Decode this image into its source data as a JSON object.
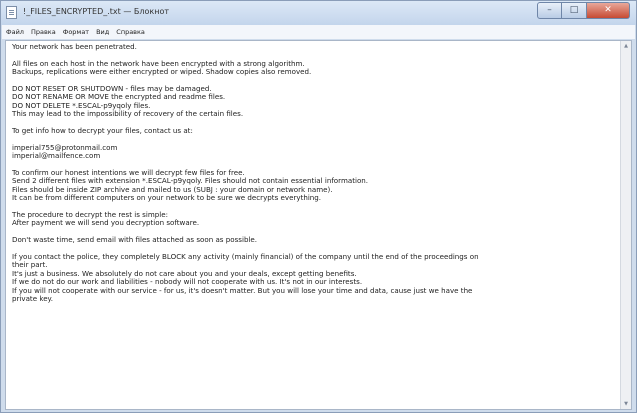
{
  "window": {
    "title": "!_FILES_ENCRYPTED_.txt — Блокнот",
    "minimize_glyph": "–",
    "maximize_glyph": "□",
    "close_glyph": "✕"
  },
  "menu": [
    "Файл",
    "Правка",
    "Формат",
    "Вид",
    "Справка"
  ],
  "document": {
    "paragraphs": [
      [
        "Your network has been penetrated."
      ],
      [
        "All files on each host in the network have been encrypted with a strong algorithm.",
        "Backups, replications were either encrypted or wiped. Shadow copies also removed."
      ],
      [
        "DO NOT RESET OR SHUTDOWN - files may be damaged.",
        "DO NOT RENAME OR MOVE the encrypted and readme files.",
        "DO NOT DELETE *.ESCAL-p9yqoly files.",
        "This may lead to the impossibility of recovery of the certain files."
      ],
      [
        "To get info how to decrypt your files, contact us at:"
      ],
      [
        "imperial755@protonmail.com",
        "imperial@mailfence.com"
      ],
      [
        "To confirm our honest intentions we will decrypt few files for free.",
        "Send 2 different files with extension *.ESCAL-p9yqoly. Files should not contain essential information.",
        "Files should be inside ZIP archive and mailed to us (SUBJ : your domain or network name).",
        "It can be from different computers on your network to be sure we decrypts everything."
      ],
      [
        "The procedure to decrypt the rest is simple:",
        "After payment we will send you decryption software."
      ],
      [
        "Don't waste time, send email with files attached as soon as possible."
      ],
      [
        "If you contact the police, they completely BLOCK any activity (mainly financial) of the company until the end of the proceedings on",
        "their part.",
        "It's just a business. We absolutely do not care about you and your deals, except getting benefits.",
        "If we do not do our work and liabilities - nobody will not cooperate with us. It's not in our interests.",
        "If you will not cooperate with our service - for us, it's doesn't matter. But you will lose your time and data, cause just we have the",
        "private key."
      ]
    ]
  },
  "icons": {
    "app": "notepad-icon",
    "scroll_up": "scroll-up-arrow-icon",
    "scroll_down": "scroll-down-arrow-icon"
  },
  "scroll_up_glyph": "▲",
  "scroll_down_glyph": "▼"
}
